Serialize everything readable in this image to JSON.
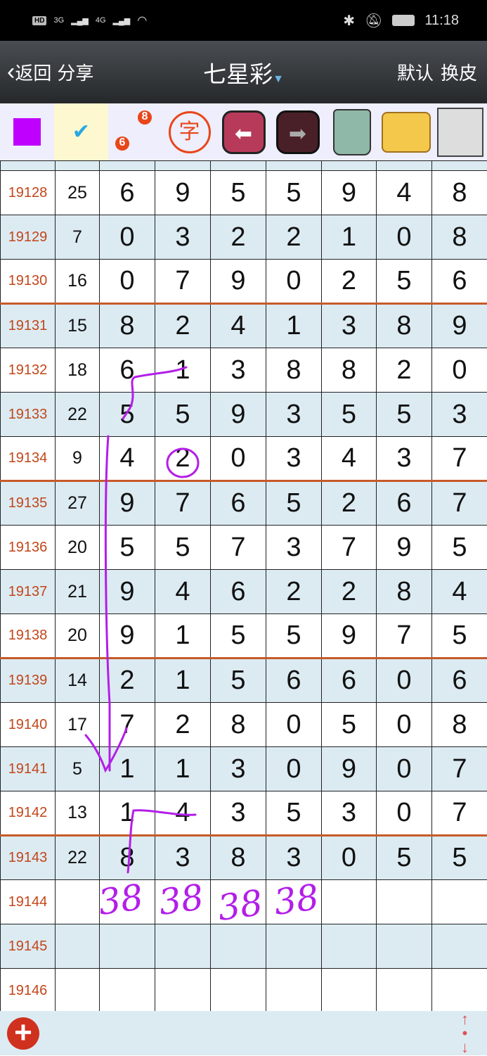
{
  "status_bar": {
    "time": "11:18",
    "network1": "3G",
    "network2": "4G",
    "hd": "HD"
  },
  "nav": {
    "back": "返回",
    "share": "分享",
    "title": "七星彩",
    "default": "默认",
    "skin": "换皮"
  },
  "toolbar": {
    "items": [
      "color-swatch",
      "pen-check",
      "link-6-8",
      "char-stamp",
      "undo-arrow",
      "redo-arrow",
      "trash",
      "photo-folder",
      "floppy-save"
    ],
    "swatch_color": "#c000ff",
    "stamp_char": "字",
    "link_from": "6",
    "link_to": "8"
  },
  "table": {
    "rows": [
      {
        "id": "19128",
        "sum": "25",
        "d": [
          "6",
          "9",
          "5",
          "5",
          "9",
          "4",
          "8"
        ]
      },
      {
        "id": "19129",
        "sum": "7",
        "d": [
          "0",
          "3",
          "2",
          "2",
          "1",
          "0",
          "8"
        ]
      },
      {
        "id": "19130",
        "sum": "16",
        "d": [
          "0",
          "7",
          "9",
          "0",
          "2",
          "5",
          "6"
        ]
      },
      {
        "id": "19131",
        "sum": "15",
        "d": [
          "8",
          "2",
          "4",
          "1",
          "3",
          "8",
          "9"
        ]
      },
      {
        "id": "19132",
        "sum": "18",
        "d": [
          "6",
          "1",
          "3",
          "8",
          "8",
          "2",
          "0"
        ]
      },
      {
        "id": "19133",
        "sum": "22",
        "d": [
          "5",
          "5",
          "9",
          "3",
          "5",
          "5",
          "3"
        ]
      },
      {
        "id": "19134",
        "sum": "9",
        "d": [
          "4",
          "2",
          "0",
          "3",
          "4",
          "3",
          "7"
        ]
      },
      {
        "id": "19135",
        "sum": "27",
        "d": [
          "9",
          "7",
          "6",
          "5",
          "2",
          "6",
          "7"
        ]
      },
      {
        "id": "19136",
        "sum": "20",
        "d": [
          "5",
          "5",
          "7",
          "3",
          "7",
          "9",
          "5"
        ]
      },
      {
        "id": "19137",
        "sum": "21",
        "d": [
          "9",
          "4",
          "6",
          "2",
          "2",
          "8",
          "4"
        ]
      },
      {
        "id": "19138",
        "sum": "20",
        "d": [
          "9",
          "1",
          "5",
          "5",
          "9",
          "7",
          "5"
        ]
      },
      {
        "id": "19139",
        "sum": "14",
        "d": [
          "2",
          "1",
          "5",
          "6",
          "6",
          "0",
          "6"
        ]
      },
      {
        "id": "19140",
        "sum": "17",
        "d": [
          "7",
          "2",
          "8",
          "0",
          "5",
          "0",
          "8"
        ]
      },
      {
        "id": "19141",
        "sum": "5",
        "d": [
          "1",
          "1",
          "3",
          "0",
          "9",
          "0",
          "7"
        ]
      },
      {
        "id": "19142",
        "sum": "13",
        "d": [
          "1",
          "4",
          "3",
          "5",
          "3",
          "0",
          "7"
        ]
      },
      {
        "id": "19143",
        "sum": "22",
        "d": [
          "8",
          "3",
          "8",
          "3",
          "0",
          "5",
          "5"
        ]
      },
      {
        "id": "19144",
        "sum": "",
        "d": [
          "",
          "",
          "",
          "",
          "",
          "",
          ""
        ]
      },
      {
        "id": "19145",
        "sum": "",
        "d": [
          "",
          "",
          "",
          "",
          "",
          "",
          ""
        ]
      },
      {
        "id": "19146",
        "sum": "",
        "d": [
          "",
          "",
          "",
          "",
          "",
          "",
          ""
        ]
      }
    ]
  },
  "handwriting": {
    "color": "#b31ee8",
    "notes": [
      "38",
      "38",
      "38",
      "38"
    ]
  },
  "colors": {
    "accent_ink": "#b31ee8",
    "id_text": "#c2461a",
    "stripe": "#dcebf2",
    "separator": "#c65a2a"
  }
}
